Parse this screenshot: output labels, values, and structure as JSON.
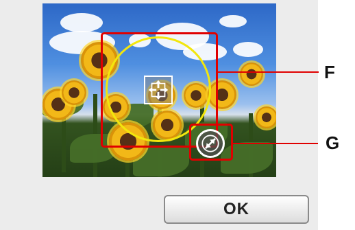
{
  "dialog": {
    "ok_label": "OK"
  },
  "annotations": {
    "f_label": "F",
    "g_label": "G"
  },
  "icons": {
    "move_icon": "four-way-arrows",
    "rotate_icon": "diagonal-resize-arrow"
  },
  "colors": {
    "callout_red": "#e00000",
    "guide_yellow": "#f2e60d",
    "panel_gray": "#ececec",
    "button_border": "#8a8a8a"
  }
}
